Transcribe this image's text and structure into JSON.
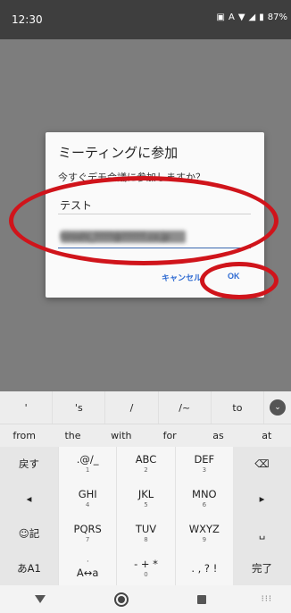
{
  "status": {
    "time": "12:30",
    "battery": "87%",
    "icons": [
      "cast-icon",
      "ai-icon",
      "wifi-icon",
      "signal-icon",
      "battery-icon"
    ]
  },
  "dialog": {
    "title": "ミーティングに参加",
    "message": "今すぐデモ会議に参加しますか？",
    "name_value": "テスト",
    "email_value": "hiroshi_????@?????.co.jp",
    "cancel_label": "キャンセル",
    "ok_label": "OK"
  },
  "keyboard": {
    "suggestions": [
      "'",
      "'s",
      "/",
      "/~",
      "to"
    ],
    "words": [
      "from",
      "the",
      "with",
      "for",
      "as",
      "at"
    ],
    "rows": [
      [
        {
          "main": "戻す"
        },
        {
          "main": ".@/_",
          "sub": "1"
        },
        {
          "main": "ABC",
          "sub": "2"
        },
        {
          "main": "DEF",
          "sub": "3"
        },
        {
          "main": "⌫"
        }
      ],
      [
        {
          "main": "◂"
        },
        {
          "main": "GHI",
          "sub": "4"
        },
        {
          "main": "JKL",
          "sub": "5"
        },
        {
          "main": "MNO",
          "sub": "6"
        },
        {
          "main": "▸"
        }
      ],
      [
        {
          "main": "☺記"
        },
        {
          "main": "PQRS",
          "sub": "7"
        },
        {
          "main": "TUV",
          "sub": "8"
        },
        {
          "main": "WXYZ",
          "sub": "9"
        },
        {
          "main": "␣"
        }
      ],
      [
        {
          "main": "あA1"
        },
        {
          "main": "A↔a",
          "sub": "'"
        },
        {
          "main": "- + *",
          "sub": "0"
        },
        {
          "main": ". , ? !"
        },
        {
          "main": "完了"
        }
      ]
    ]
  },
  "colors": {
    "accent": "#2f6bd2",
    "annotation": "#d0141b"
  }
}
